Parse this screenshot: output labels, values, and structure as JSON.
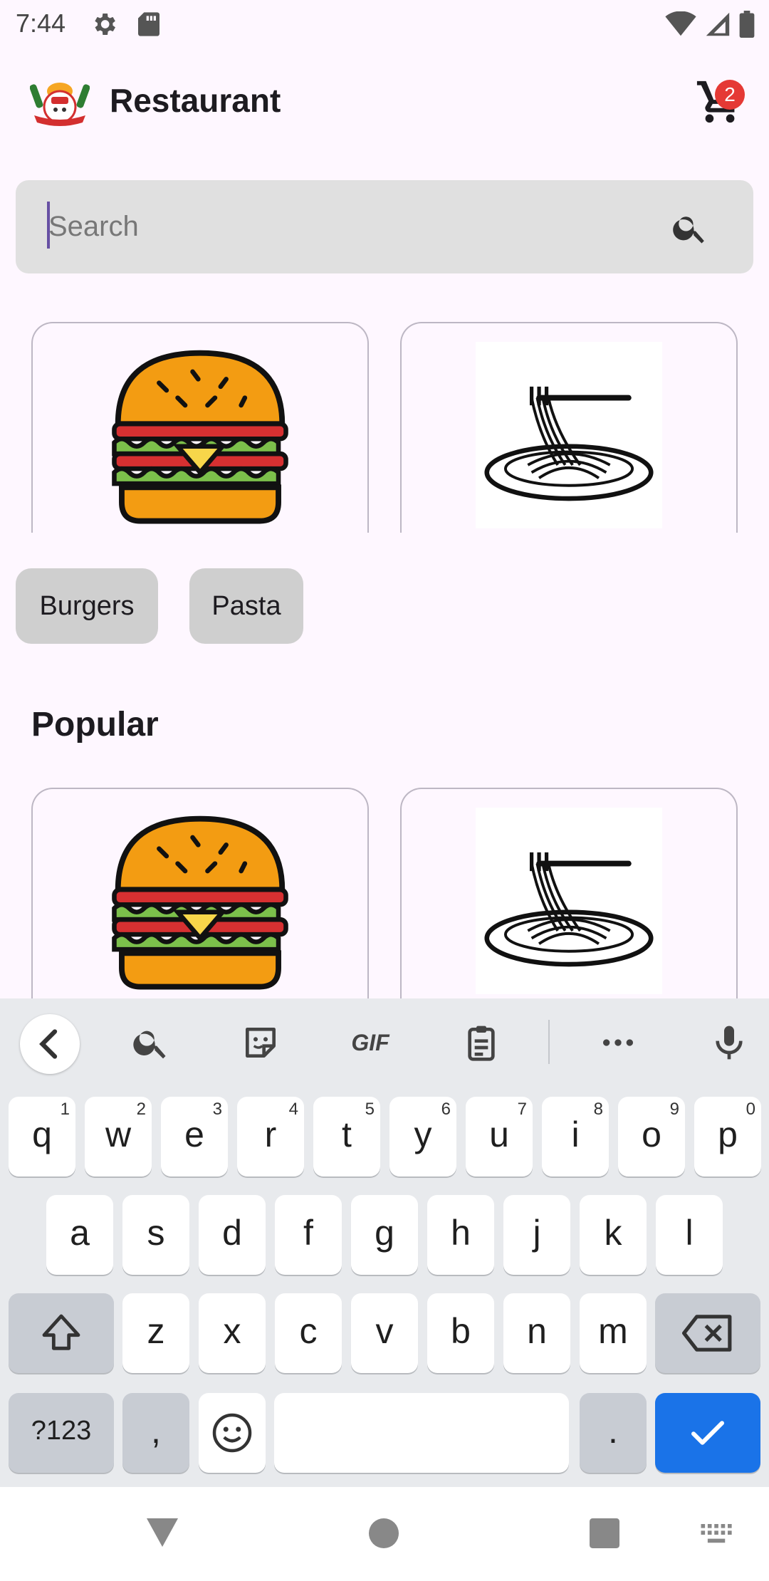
{
  "status_bar": {
    "time": "7:44"
  },
  "app_bar": {
    "title": "Restaurant",
    "cart_count": "2"
  },
  "search": {
    "placeholder": "Search",
    "value": ""
  },
  "categories": [
    {
      "label": "Burgers",
      "image": "burger-image"
    },
    {
      "label": "Pasta",
      "image": "pasta-image"
    }
  ],
  "popular": {
    "title": "Popular",
    "items": [
      {
        "image": "burger-image"
      },
      {
        "image": "pasta-image"
      }
    ]
  },
  "keyboard": {
    "toolbar": [
      "back-icon",
      "search-icon",
      "sticker-icon",
      "GIF",
      "clipboard-icon",
      "more-icon",
      "mic-icon"
    ],
    "row1": [
      "q",
      "w",
      "e",
      "r",
      "t",
      "y",
      "u",
      "i",
      "o",
      "p"
    ],
    "row1_hints": [
      "1",
      "2",
      "3",
      "4",
      "5",
      "6",
      "7",
      "8",
      "9",
      "0"
    ],
    "row2": [
      "a",
      "s",
      "d",
      "f",
      "g",
      "h",
      "j",
      "k",
      "l"
    ],
    "row3": [
      "z",
      "x",
      "c",
      "v",
      "b",
      "n",
      "m"
    ],
    "symbols_label": "?123",
    "comma": ",",
    "period": "."
  },
  "colors": {
    "accent": "#6750A4",
    "badge": "#E53935",
    "enter_key": "#1A73E8",
    "background": "#FEF7FF"
  }
}
